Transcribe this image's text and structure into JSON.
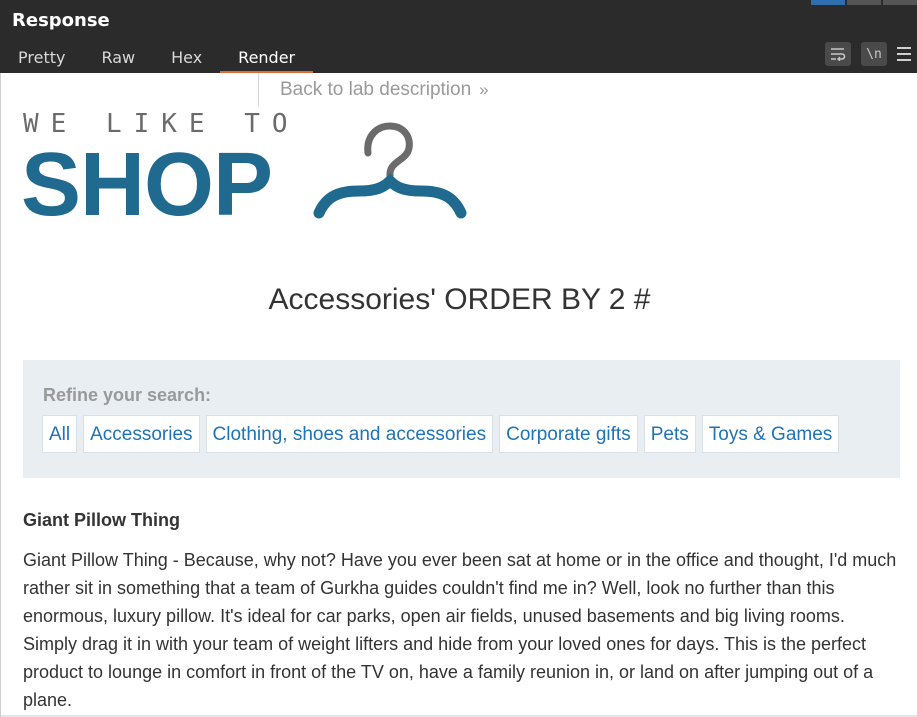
{
  "panel": {
    "title": "Response",
    "tabs": [
      "Pretty",
      "Raw",
      "Hex",
      "Render"
    ],
    "active_tab": "Render",
    "toolbar": {
      "wrap_icon": "word-wrap-icon",
      "newline_label": "\\n",
      "menu_icon": "hamburger-menu-icon"
    }
  },
  "page": {
    "back_link": "Back to lab description",
    "back_chevron": "»",
    "logo": {
      "tagline": "WE LIKE TO",
      "brand": "SHOP",
      "icon": "hanger-icon"
    },
    "heading": "Accessories' ORDER BY 2 #",
    "refine": {
      "label": "Refine your search:",
      "filters": [
        "All",
        "Accessories",
        "Clothing, shoes and accessories",
        "Corporate gifts",
        "Pets",
        "Toys & Games"
      ]
    },
    "product": {
      "name": "Giant Pillow Thing",
      "description": "Giant Pillow Thing - Because, why not? Have you ever been sat at home or in the office and thought, I'd much rather sit in something that a team of Gurkha guides couldn't find me in? Well, look no further than this enormous, luxury pillow. It's ideal for car parks, open air fields, unused basements and big living rooms. Simply drag it in with your team of weight lifters and hide from your loved ones for days. This is the perfect product to lounge in comfort in front of the TV on, have a family reunion in, or land on after jumping out of a plane."
    }
  },
  "colors": {
    "panel_bg": "#2b2b2b",
    "active_tab_underline": "#e06b35",
    "brand_blue": "#1f6a8e",
    "link_blue": "#1f73b7",
    "refine_bg": "#e8eef2"
  }
}
